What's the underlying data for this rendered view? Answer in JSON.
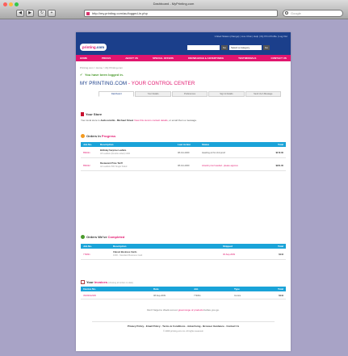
{
  "browser": {
    "window_title": "Dashboard - MyPrinting.com",
    "address": "http://my.printing.com/au/logged-in.php",
    "search_placeholder": "Google",
    "back_glyph": "◀",
    "forward_glyph": "▶",
    "reload_glyph": "↻",
    "home_glyph": "+",
    "colors": {
      "close": "#fc605c",
      "minimize": "#fdbc40",
      "zoom": "#34c84a"
    }
  },
  "header": {
    "logo_prefix": "printing",
    "logo_suffix": ".com",
    "top_links": "United States (change) | Live Chat | Help | My Print Profile | Log Out",
    "search_go": "Go",
    "category_select": "Select a category",
    "category_go": "Go"
  },
  "menu": [
    "HOME",
    "PRICES",
    "ABOUT US",
    "SPECIAL OFFERS",
    "KNOWLEDGE & ADVERTISING",
    "TESTIMONIALS",
    "CONTACT US"
  ],
  "breadcrumb": "Printing.com > Home > My Printing.com",
  "logged_in": "You have been logged in.",
  "title": {
    "main": "MY PRINTING.COM",
    "separator": " - ",
    "highlight": "YOUR CONTROL CENTER"
  },
  "tabs": [
    "Dashboard",
    "Your Details",
    "Preferences",
    "Sign & Details",
    "Send Us A Message"
  ],
  "store": {
    "heading": "Your Store",
    "line_prefix": "Your local store is ",
    "store_name": "Jacksonville - Michael Street",
    "line_middle": " View this store's contact details",
    "line_suffix": ", or email them a message."
  },
  "progress": {
    "heading": "Orders In ",
    "heading_hi": "Progress",
    "columns": [
      "Job No.",
      "Description",
      "Last Action",
      "Status",
      "Total"
    ],
    "rows": [
      {
        "job": "854021",
        "desc": "Birthday Surprise Leaflets",
        "desc_sub": "A5 Leaflets (Double sided) 1000",
        "action": "08-Oct-2009",
        "status": "Awaiting art for 2nd proof",
        "total": "$172.00"
      },
      {
        "job": "854022",
        "desc": "Restaurant Price Tariff",
        "desc_sub": "A4 Leaflets 500 Single Sided",
        "action": "08-Oct-2009",
        "status": "Artwork proof needed - please approve",
        "total": "$221.00"
      }
    ]
  },
  "completed": {
    "heading": "Orders We've ",
    "heading_hi": "Completed",
    "columns": [
      "Job No.",
      "Description",
      "Shipped",
      "Total"
    ],
    "rows": [
      {
        "job": "774821",
        "desc": "Classic Business Cards",
        "desc_sub": "1000 - Standard Business Card",
        "shipped": "06-Sep-2009",
        "total": "$144"
      }
    ]
  },
  "invoices": {
    "heading": "Your ",
    "heading_hi": "Invoices",
    "heading_note": " (showing all orders to date)",
    "columns": [
      "Invoice No.",
      "Date",
      "Job",
      "Type",
      "Total"
    ],
    "rows": [
      {
        "invoice": "INV00012345",
        "date": "08-Sep-2009",
        "job": "774821",
        "type": "Invoice",
        "total": "$144"
      }
    ]
  },
  "reminder": {
    "prefix": "Don't forget to check out our ",
    "link": "great range of products",
    "suffix": " before you go."
  },
  "footer": {
    "links": "Privacy Policy · Email Policy · Terms & Conditions · Advertising · Browser Guidance · Contact Us",
    "copyright": "© 2009 printing.com inc. All rights reserved."
  }
}
